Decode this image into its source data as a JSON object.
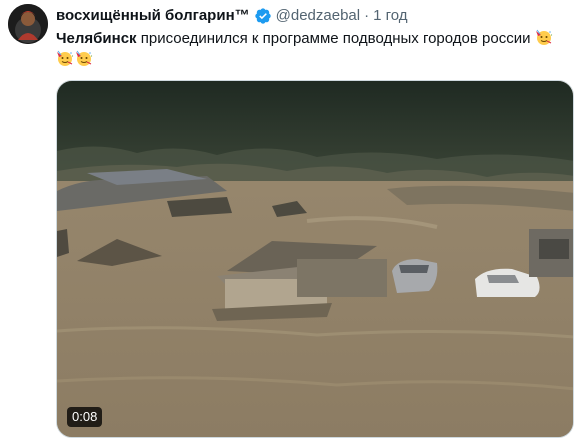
{
  "tweet": {
    "display_name": "восхищённый болгарин™",
    "handle": "@dedzaebal",
    "separator": "·",
    "time": "1 год",
    "text_bold": "Челябинск",
    "text_rest": " присоединился к программе подводных городов россии"
  },
  "icons": {
    "verified": "verified-badge-icon",
    "emoji": "partying-face-emoji"
  },
  "colors": {
    "verified_blue": "#1d9bf0",
    "secondary_text": "#536471"
  },
  "media": {
    "duration": "0:08"
  }
}
